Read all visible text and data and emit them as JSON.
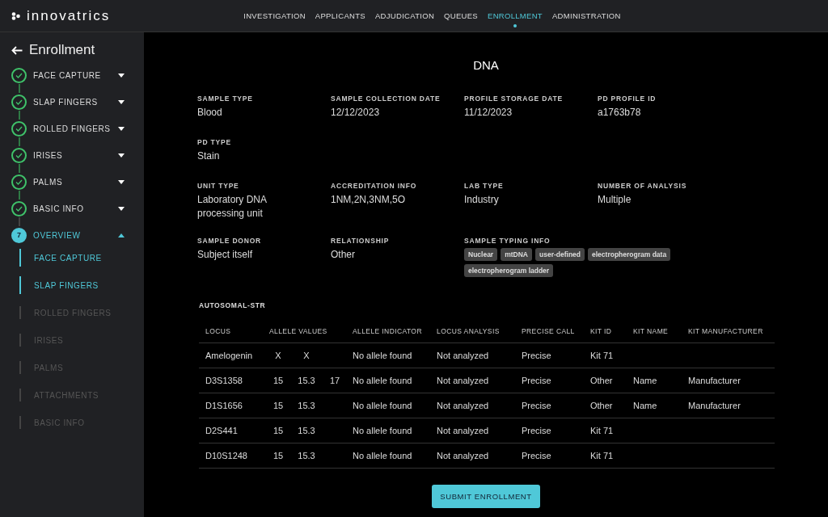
{
  "brand": "innovatrics",
  "nav": [
    {
      "label": "INVESTIGATION",
      "selected": false
    },
    {
      "label": "APPLICANTS",
      "selected": false
    },
    {
      "label": "ADJUDICATION",
      "selected": false
    },
    {
      "label": "QUEUES",
      "selected": false
    },
    {
      "label": "ENROLLMENT",
      "selected": true
    },
    {
      "label": "ADMINISTRATION",
      "selected": false
    }
  ],
  "sidebar": {
    "title": "Enrollment",
    "steps": [
      {
        "label": "FACE CAPTURE",
        "completed": true,
        "expanded": false
      },
      {
        "label": "SLAP FINGERS",
        "completed": true,
        "expanded": false
      },
      {
        "label": "ROLLED FINGERS",
        "completed": true,
        "expanded": false
      },
      {
        "label": "IRISES",
        "completed": true,
        "expanded": false
      },
      {
        "label": "PALMS",
        "completed": true,
        "expanded": false
      },
      {
        "label": "BASIC INFO",
        "completed": true,
        "expanded": false
      },
      {
        "label": "OVERVIEW",
        "completed": false,
        "number": "7",
        "expanded": true,
        "children": [
          {
            "label": "FACE CAPTURE",
            "available": true
          },
          {
            "label": "SLAP FINGERS",
            "available": true
          },
          {
            "label": "ROLLED FINGERS",
            "available": false
          },
          {
            "label": "IRISES",
            "available": false
          },
          {
            "label": "PALMS",
            "available": false
          },
          {
            "label": "ATTACHMENTS",
            "available": false
          },
          {
            "label": "BASIC INFO",
            "available": false
          }
        ]
      }
    ]
  },
  "page_title": "DNA",
  "fields": [
    {
      "label": "SAMPLE TYPE",
      "value": "Blood"
    },
    {
      "label": "SAMPLE COLLECTION DATE",
      "value": "12/12/2023"
    },
    {
      "label": "PROFILE STORAGE DATE",
      "value": "11/12/2023"
    },
    {
      "label": "PD PROFILE ID",
      "value": "a1763b78"
    },
    {
      "label": "PD TYPE",
      "value": "Stain"
    },
    {
      "label": "UNIT TYPE",
      "value": "Laboratory DNA processing unit"
    },
    {
      "label": "ACCREDITATION INFO",
      "value": "1NM,2N,3NM,5O"
    },
    {
      "label": "LAB TYPE",
      "value": "Industry"
    },
    {
      "label": "NUMBER OF ANALYSIS",
      "value": "Multiple"
    },
    {
      "label": "SAMPLE DONOR",
      "value": "Subject itself"
    },
    {
      "label": "RELATIONSHIP",
      "value": "Other"
    },
    {
      "label": "SAMPLE TYPING INFO",
      "tags": [
        "Nuclear",
        "mtDNA",
        "user-defined",
        "electropherogram data",
        "electropherogram ladder"
      ]
    }
  ],
  "table": {
    "title": "AUTOSOMAL-STR",
    "columns": [
      "LOCUS",
      "ALLELE VALUES",
      "ALLELE INDICATOR",
      "LOCUS ANALYSIS",
      "PRECISE CALL",
      "KIT ID",
      "KIT NAME",
      "KIT MANUFACTURER"
    ],
    "rows": [
      {
        "locus": "Amelogenin",
        "alleles": [
          "X",
          "X"
        ],
        "indicator": "No allele found",
        "analysis": "Not analyzed",
        "call": "Precise",
        "kit_id": "Kit 71"
      },
      {
        "locus": "D3S1358",
        "alleles": [
          "15",
          "15.3",
          "17"
        ],
        "indicator": "No allele found",
        "analysis": "Not analyzed",
        "call": "Precise",
        "kit_id": "Other",
        "kit_name": "Name",
        "kit_manufacturer": "Manufacturer"
      },
      {
        "locus": "D1S1656",
        "alleles": [
          "15",
          "15.3"
        ],
        "indicator": "No allele found",
        "analysis": "Not analyzed",
        "call": "Precise",
        "kit_id": "Other",
        "kit_name": "Name",
        "kit_manufacturer": "Manufacturer"
      },
      {
        "locus": "D2S441",
        "alleles": [
          "15",
          "15.3"
        ],
        "indicator": "No allele found",
        "analysis": "Not analyzed",
        "call": "Precise",
        "kit_id": "Kit 71"
      },
      {
        "locus": "D10S1248",
        "alleles": [
          "15",
          "15.3"
        ],
        "indicator": "No allele found",
        "analysis": "Not analyzed",
        "call": "Precise",
        "kit_id": "Kit 71"
      }
    ]
  },
  "submit_button": "SUBMIT ENROLLMENT"
}
